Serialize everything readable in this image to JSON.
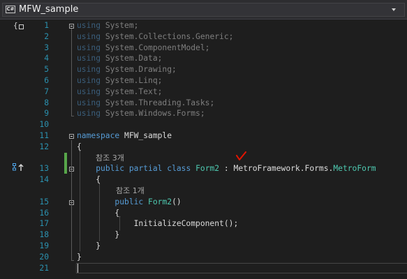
{
  "nav": {
    "type_icon": "C#",
    "label": "MFW_sample"
  },
  "lines": [
    {
      "n": "1",
      "tokens": [
        {
          "t": "using",
          "k": "kw"
        },
        {
          "t": " System;"
        }
      ],
      "dim": true
    },
    {
      "n": "2",
      "tokens": [
        {
          "t": "using",
          "k": "kw"
        },
        {
          "t": " System.Collections.Generic;"
        }
      ],
      "dim": true
    },
    {
      "n": "3",
      "tokens": [
        {
          "t": "using",
          "k": "kw"
        },
        {
          "t": " System.ComponentModel;"
        }
      ],
      "dim": true
    },
    {
      "n": "4",
      "tokens": [
        {
          "t": "using",
          "k": "kw"
        },
        {
          "t": " System.Data;"
        }
      ],
      "dim": true
    },
    {
      "n": "5",
      "tokens": [
        {
          "t": "using",
          "k": "kw"
        },
        {
          "t": " System.Drawing;"
        }
      ],
      "dim": true
    },
    {
      "n": "6",
      "tokens": [
        {
          "t": "using",
          "k": "kw"
        },
        {
          "t": " System.Linq;"
        }
      ],
      "dim": true
    },
    {
      "n": "7",
      "tokens": [
        {
          "t": "using",
          "k": "kw"
        },
        {
          "t": " System.Text;"
        }
      ],
      "dim": true
    },
    {
      "n": "8",
      "tokens": [
        {
          "t": "using",
          "k": "kw"
        },
        {
          "t": " System.Threading.Tasks;"
        }
      ],
      "dim": true
    },
    {
      "n": "9",
      "tokens": [
        {
          "t": "using",
          "k": "kw"
        },
        {
          "t": " System.Windows.Forms;"
        }
      ],
      "dim": true
    },
    {
      "n": "10",
      "tokens": []
    },
    {
      "n": "11",
      "tokens": [
        {
          "t": "namespace",
          "k": "kw"
        },
        {
          "t": " MFW_sample"
        }
      ]
    },
    {
      "n": "12",
      "tokens": [
        {
          "t": "{"
        }
      ]
    },
    {
      "n": "",
      "codelens": "참조 3개"
    },
    {
      "n": "13",
      "tokens": [
        {
          "t": "    "
        },
        {
          "t": "public",
          "k": "kw"
        },
        {
          "t": " "
        },
        {
          "t": "partial",
          "k": "kw"
        },
        {
          "t": " "
        },
        {
          "t": "class",
          "k": "kw"
        },
        {
          "t": " "
        },
        {
          "t": "Form2",
          "k": "ty"
        },
        {
          "t": " : MetroFramework.Forms."
        },
        {
          "t": "MetroForm",
          "k": "ty"
        }
      ]
    },
    {
      "n": "14",
      "tokens": [
        {
          "t": "    {"
        }
      ]
    },
    {
      "n": "",
      "codelens": "참조 1개",
      "indent": 2
    },
    {
      "n": "15",
      "tokens": [
        {
          "t": "        "
        },
        {
          "t": "public",
          "k": "kw"
        },
        {
          "t": " "
        },
        {
          "t": "Form2",
          "k": "ty"
        },
        {
          "t": "()"
        }
      ]
    },
    {
      "n": "16",
      "tokens": [
        {
          "t": "        {"
        }
      ]
    },
    {
      "n": "17",
      "tokens": [
        {
          "t": "            InitializeComponent();"
        }
      ]
    },
    {
      "n": "18",
      "tokens": [
        {
          "t": "        }"
        }
      ]
    },
    {
      "n": "19",
      "tokens": [
        {
          "t": "    }"
        }
      ]
    },
    {
      "n": "20",
      "tokens": [
        {
          "t": "}"
        }
      ]
    },
    {
      "n": "21",
      "tokens": []
    }
  ],
  "colors": {
    "keyword": "#569cd6",
    "type": "#4ec9b0",
    "text": "#dcdcdc",
    "line_number": "#2b91af",
    "codelens": "#a8a8a8",
    "change_bar": "#57a64a",
    "annotation": "#e51400",
    "background": "#1e1e1e"
  },
  "icons": {
    "scope": "brace-scope-icon",
    "hierarchy": "class-hierarchy-icon",
    "check": "red-checkmark-annotation"
  }
}
